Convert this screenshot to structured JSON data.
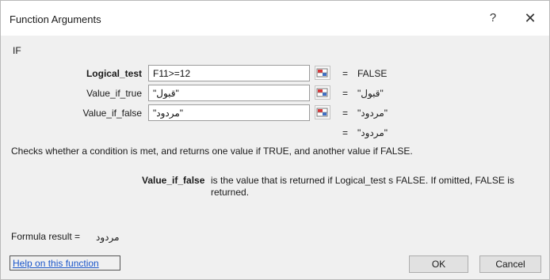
{
  "dialog": {
    "title": "Function Arguments",
    "help_glyph": "?",
    "close_glyph": "✕"
  },
  "function_name": "IF",
  "arguments": [
    {
      "label": "Logical_test",
      "value": "F11>=12",
      "result": "FALSE",
      "bold": true
    },
    {
      "label": "Value_if_true",
      "value": "\"قبول\"",
      "result": "\"قبول\"",
      "bold": false
    },
    {
      "label": "Value_if_false",
      "value": "\"مردود\"",
      "result": "\"مردود\"",
      "bold": false
    }
  ],
  "equals_sign": "=",
  "overall_result": "\"مردود\"",
  "description": "Checks whether a condition is met, and returns one value if TRUE, and another value if FALSE.",
  "param_help": {
    "name": "Value_if_false",
    "text": "is the value that is returned if Logical_test s FALSE. If omitted, FALSE is returned."
  },
  "formula_result": {
    "label": "Formula result =",
    "value": "مردود"
  },
  "footer": {
    "help_link": "Help on this function",
    "ok_label": "OK",
    "cancel_label": "Cancel"
  },
  "colors": {
    "link": "#1a55c9",
    "ref_icon_red": "#d9383a",
    "ref_icon_blue": "#3f6fc6"
  }
}
